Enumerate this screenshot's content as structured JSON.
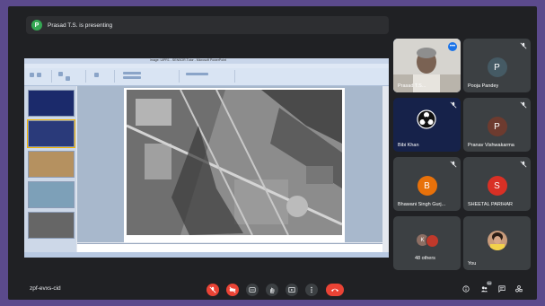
{
  "banner": {
    "avatar_initial": "P",
    "text": "Prasad T.S. is presenting"
  },
  "slide": {
    "window_title": "image: UIPR1 - SENSOR.Tutor - Microsoft PowerPoint",
    "menu": [
      "Home",
      "Insert",
      "Design",
      "Animations",
      "Slide Show",
      "Review",
      "View"
    ],
    "notes_placeholder": "Click to add notes"
  },
  "participants": [
    {
      "name": "Prasad T.S...",
      "type": "video"
    },
    {
      "name": "Pooja Pandey",
      "initial": "P",
      "color": "#455a64"
    },
    {
      "name": "Bibi Khan",
      "type": "logo"
    },
    {
      "name": "Pranav Vishwakarma",
      "initial": "P",
      "color": "#6d3b2f"
    },
    {
      "name": "Bhawani Singh Gurj...",
      "initial": "B",
      "color": "#e8710a"
    },
    {
      "name": "SHEETAL PARIHAR",
      "initial": "S",
      "color": "#e8430a"
    },
    {
      "name": "48 others",
      "initial": "K"
    },
    {
      "name": "You"
    }
  ],
  "meeting": {
    "code": "zpf-evxs-cid"
  },
  "controls": {
    "mic": "mic-off",
    "camera": "camera-off",
    "captions": "CC",
    "hand": "raise-hand",
    "present": "present",
    "more": "more",
    "end": "end-call"
  },
  "right_controls": {
    "people_count": "54"
  },
  "colors": {
    "background": "#202124",
    "tile": "#3c4043",
    "accent": "#8ab4f8",
    "danger": "#ea4335",
    "frame": "#5b4a8c"
  }
}
